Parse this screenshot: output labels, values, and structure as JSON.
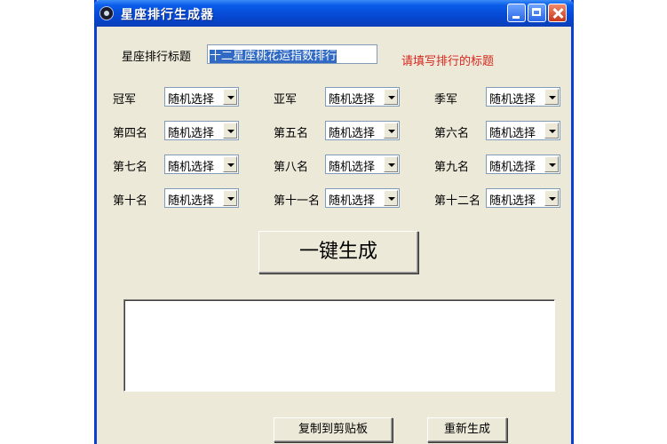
{
  "window": {
    "title": "星座排行生成器"
  },
  "form": {
    "title_label": "星座排行标题",
    "title_value": "十二星座桃花运指数排行",
    "hint": "请填写排行的标题"
  },
  "ranks": [
    {
      "label": "冠军",
      "value": "随机选择"
    },
    {
      "label": "亚军",
      "value": "随机选择"
    },
    {
      "label": "季军",
      "value": "随机选择"
    },
    {
      "label": "第四名",
      "value": "随机选择"
    },
    {
      "label": "第五名",
      "value": "随机选择"
    },
    {
      "label": "第六名",
      "value": "随机选择"
    },
    {
      "label": "第七名",
      "value": "随机选择"
    },
    {
      "label": "第八名",
      "value": "随机选择"
    },
    {
      "label": "第九名",
      "value": "随机选择"
    },
    {
      "label": "第十名",
      "value": "随机选择"
    },
    {
      "label": "第十一名",
      "value": "随机选择"
    },
    {
      "label": "第十二名",
      "value": "随机选择"
    }
  ],
  "buttons": {
    "generate": "一键生成",
    "copy": "复制到剪贴板",
    "regenerate": "重新生成"
  },
  "output": {
    "text": ""
  },
  "icons": {
    "app": "zodiac-icon",
    "minimize": "minimize-icon",
    "maximize": "maximize-icon",
    "close": "close-icon"
  },
  "colors": {
    "titlebar": "#0548d4",
    "hint": "#d7261e",
    "selection": "#316ac5",
    "window_bg": "#ece9d8"
  }
}
